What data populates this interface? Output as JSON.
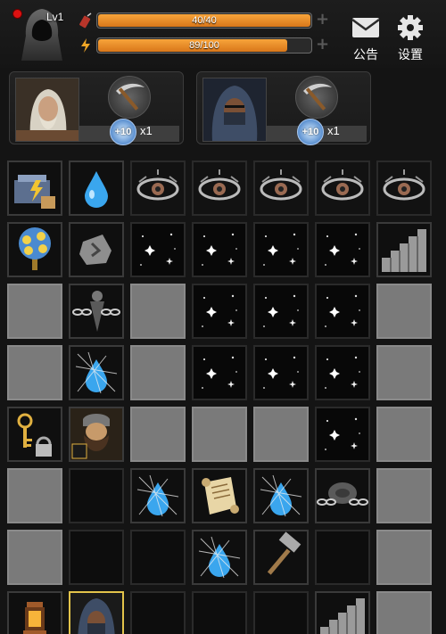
{
  "player": {
    "level": "Lv1",
    "stamina_text": "40/40",
    "stamina_fill": 1.0,
    "energy_text": "89/100",
    "energy_fill": 0.89,
    "stamina_icon": "dynamite-icon",
    "energy_icon": "lightning-icon"
  },
  "topbar": {
    "announcement_label": "公告",
    "settings_label": "设置"
  },
  "characters": [
    {
      "portrait": "old-sage-portrait",
      "bonus": "+10",
      "multiplier": "x1",
      "tool": "pickaxe-icon"
    },
    {
      "portrait": "hooded-rogue-portrait",
      "bonus": "+10",
      "multiplier": "x1",
      "tool": "pickaxe-icon"
    }
  ],
  "grid": {
    "columns": 7,
    "rows": [
      [
        "toolbox",
        "water",
        "eye",
        "eye",
        "eye",
        "eye",
        "eye"
      ],
      [
        "crystal-tree",
        "rune-stone",
        "star",
        "star",
        "star",
        "star",
        "stairs"
      ],
      [
        "locked",
        "chain-sword",
        "locked",
        "star",
        "star",
        "star",
        "locked"
      ],
      [
        "locked",
        "web-water",
        "locked",
        "star",
        "star",
        "star",
        "locked"
      ],
      [
        "key-lock",
        "dwarf",
        "locked",
        "locked",
        "locked",
        "star",
        "locked"
      ],
      [
        "locked",
        "empty",
        "web-water",
        "scroll",
        "web-water",
        "chain-rock",
        "locked"
      ],
      [
        "locked",
        "empty",
        "empty",
        "web-water",
        "hammer",
        "empty",
        "locked"
      ],
      [
        "lantern",
        "hooded-selected",
        "empty",
        "empty",
        "empty",
        "stairs",
        "locked"
      ]
    ]
  },
  "colors": {
    "bar_fill": "#e88a25",
    "selected_border": "#e2c34a",
    "locked_tile": "#7a7a7a",
    "notice_dot": "#dd1111"
  }
}
